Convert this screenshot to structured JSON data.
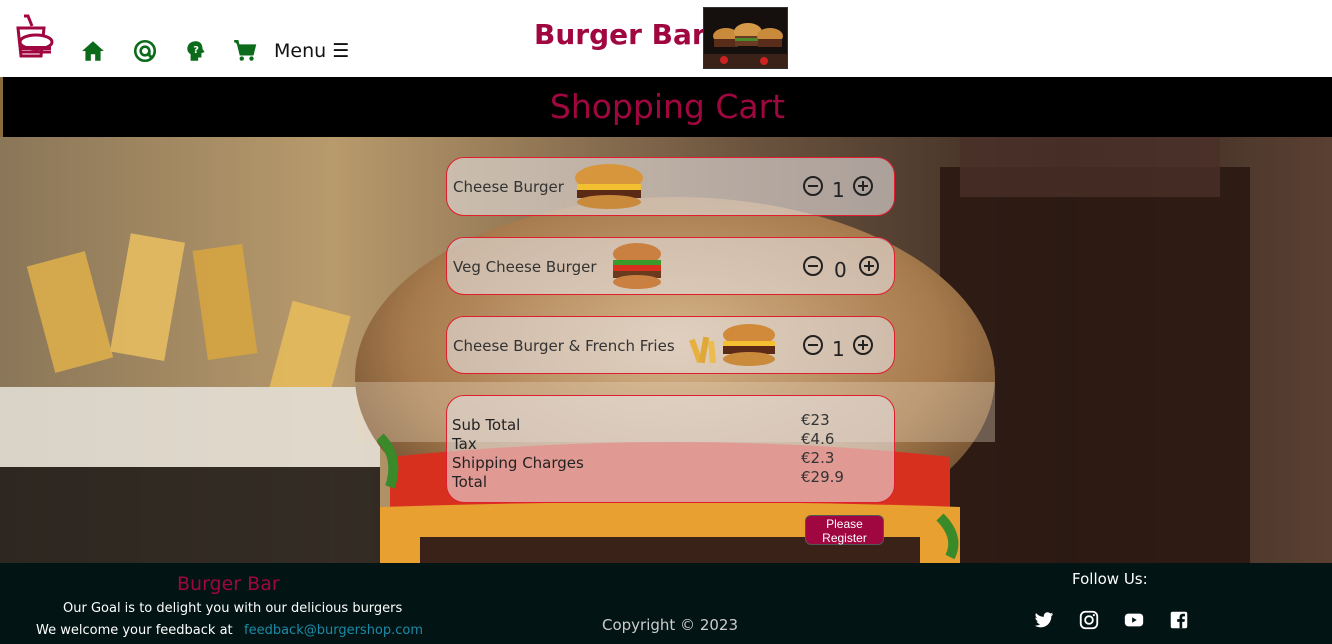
{
  "header": {
    "brand": "Burger Bar",
    "menu_label": "Menu ☰",
    "nav_icons": [
      "logo-icon",
      "home-icon",
      "at-icon",
      "help-icon",
      "cart-icon"
    ],
    "accent": "#a0063f",
    "nav_color": "#0b6b1a"
  },
  "page": {
    "title": "Shopping Cart"
  },
  "cart": {
    "items": [
      {
        "name": "Cheese Burger",
        "qty": "1"
      },
      {
        "name": "Veg Cheese Burger",
        "qty": "0"
      },
      {
        "name": "Cheese Burger & French Fries",
        "qty": "1"
      }
    ],
    "totals": {
      "subtotal_label": "Sub Total",
      "tax_label": "Tax",
      "shipping_label": "Shipping Charges",
      "total_label": "Total",
      "subtotal": "€23",
      "tax": "€4.6",
      "shipping": "€2.3",
      "total": "€29.9"
    },
    "register_label": "Please Register"
  },
  "footer": {
    "brand": "Burger Bar",
    "goal": "Our Goal is to delight you with our delicious burgers",
    "feedback_text": "We welcome your feedback at",
    "email": "feedback@burgershop.com",
    "copyright": "Copyright © 2023",
    "follow": "Follow Us:",
    "social_icons": [
      "twitter-icon",
      "instagram-icon",
      "youtube-icon",
      "facebook-icon"
    ]
  }
}
